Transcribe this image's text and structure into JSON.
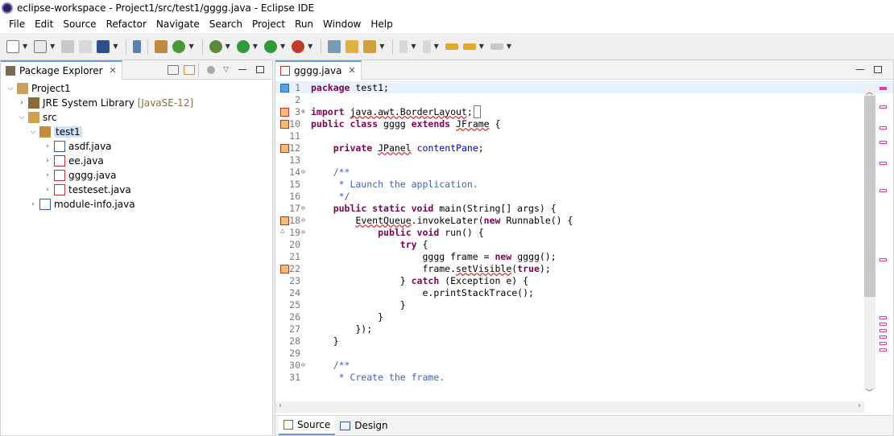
{
  "window": {
    "title": "eclipse-workspace - Project1/src/test1/gggg.java - Eclipse IDE"
  },
  "menu": [
    "File",
    "Edit",
    "Source",
    "Refactor",
    "Navigate",
    "Search",
    "Project",
    "Run",
    "Window",
    "Help"
  ],
  "package_explorer": {
    "tab_label": "Package Explorer",
    "tree": {
      "project": "Project1",
      "jre": "JRE System Library",
      "jre_version": "[JavaSE-12]",
      "src": "src",
      "package": "test1",
      "files": [
        "asdf.java",
        "ee.java",
        "gggg.java",
        "testeset.java"
      ],
      "module": "module-info.java"
    }
  },
  "editor": {
    "tab_label": "gggg.java",
    "bottom_tabs": [
      "Source",
      "Design"
    ],
    "lines": [
      {
        "n": "1",
        "text": "package test1;"
      },
      {
        "n": "2",
        "text": ""
      },
      {
        "n": "3",
        "text": "import java.awt.BorderLayout;"
      },
      {
        "n": "10",
        "text": "public class gggg extends JFrame {"
      },
      {
        "n": "11",
        "text": ""
      },
      {
        "n": "12",
        "text": "private JPanel contentPane;"
      },
      {
        "n": "13",
        "text": ""
      },
      {
        "n": "14",
        "text": "/**"
      },
      {
        "n": "15",
        "text": " * Launch the application."
      },
      {
        "n": "16",
        "text": " */"
      },
      {
        "n": "17",
        "text": "public static void main(String[] args) {"
      },
      {
        "n": "18",
        "text": "EventQueue.invokeLater(new Runnable() {"
      },
      {
        "n": "19",
        "text": "public void run() {"
      },
      {
        "n": "20",
        "text": "try {"
      },
      {
        "n": "21",
        "text": "gggg frame = new gggg();"
      },
      {
        "n": "22",
        "text": "frame.setVisible(true);"
      },
      {
        "n": "23",
        "text": "} catch (Exception e) {"
      },
      {
        "n": "24",
        "text": "e.printStackTrace();"
      },
      {
        "n": "25",
        "text": "}"
      },
      {
        "n": "26",
        "text": "}"
      },
      {
        "n": "27",
        "text": "});"
      },
      {
        "n": "28",
        "text": "}"
      },
      {
        "n": "29",
        "text": ""
      },
      {
        "n": "30",
        "text": "/**"
      },
      {
        "n": "31",
        "text": " * Create the frame."
      }
    ]
  },
  "colors": {
    "keyword": "#7f0055",
    "comment": "#3f5fbf",
    "field": "#0000c0",
    "error": "#dd2222",
    "selection": "#cde3f7"
  }
}
